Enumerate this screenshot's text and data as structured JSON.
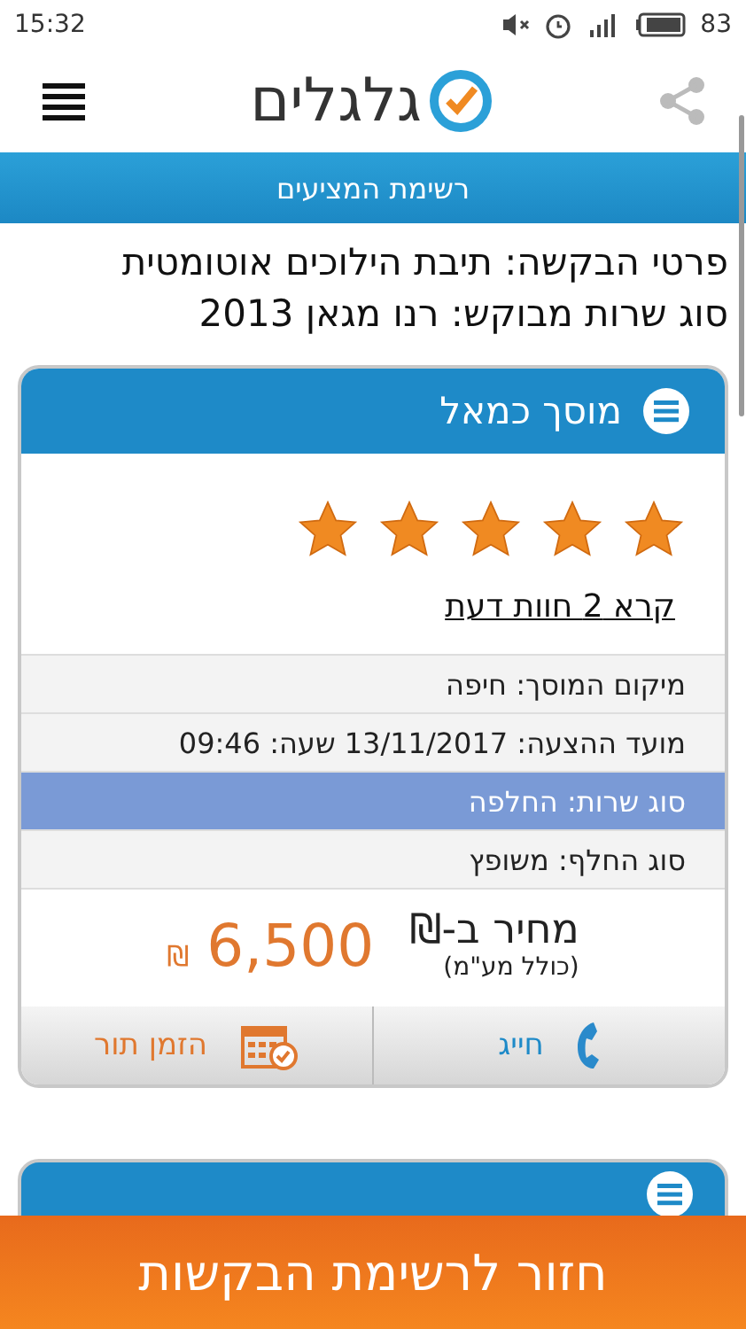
{
  "status_bar": {
    "time": "15:32",
    "battery": "83"
  },
  "header": {
    "logo": "גלגלים"
  },
  "title_bar": "רשימת המציעים",
  "request": {
    "lines": [
      "פרטי הבקשה: תיבת הילוכים אוטומטית",
      "סוג שרות מבוקש: רנו מגאן 2013"
    ]
  },
  "offer": {
    "name": "מוסך כמאל",
    "stars": 5,
    "reviews_link": "קרא 2 חוות דעת",
    "rows": [
      {
        "text": "מיקום המוסך: חיפה",
        "highlighted": false
      },
      {
        "text": "מועד ההצעה: 13/11/2017 שעה: 09:46",
        "highlighted": false
      },
      {
        "text": "סוג שרות: החלפה",
        "highlighted": true
      },
      {
        "text": "סוג החלף: משופץ",
        "highlighted": false
      }
    ],
    "price_label": "מחיר ב-₪",
    "price_note": "(כולל מע\"מ)",
    "price": "6,500",
    "currency": "₪",
    "actions": [
      {
        "kind": "call",
        "label": "חייג"
      },
      {
        "kind": "book",
        "label": "הזמן תור"
      }
    ]
  },
  "back_button": "חזור לרשימת הבקשות"
}
